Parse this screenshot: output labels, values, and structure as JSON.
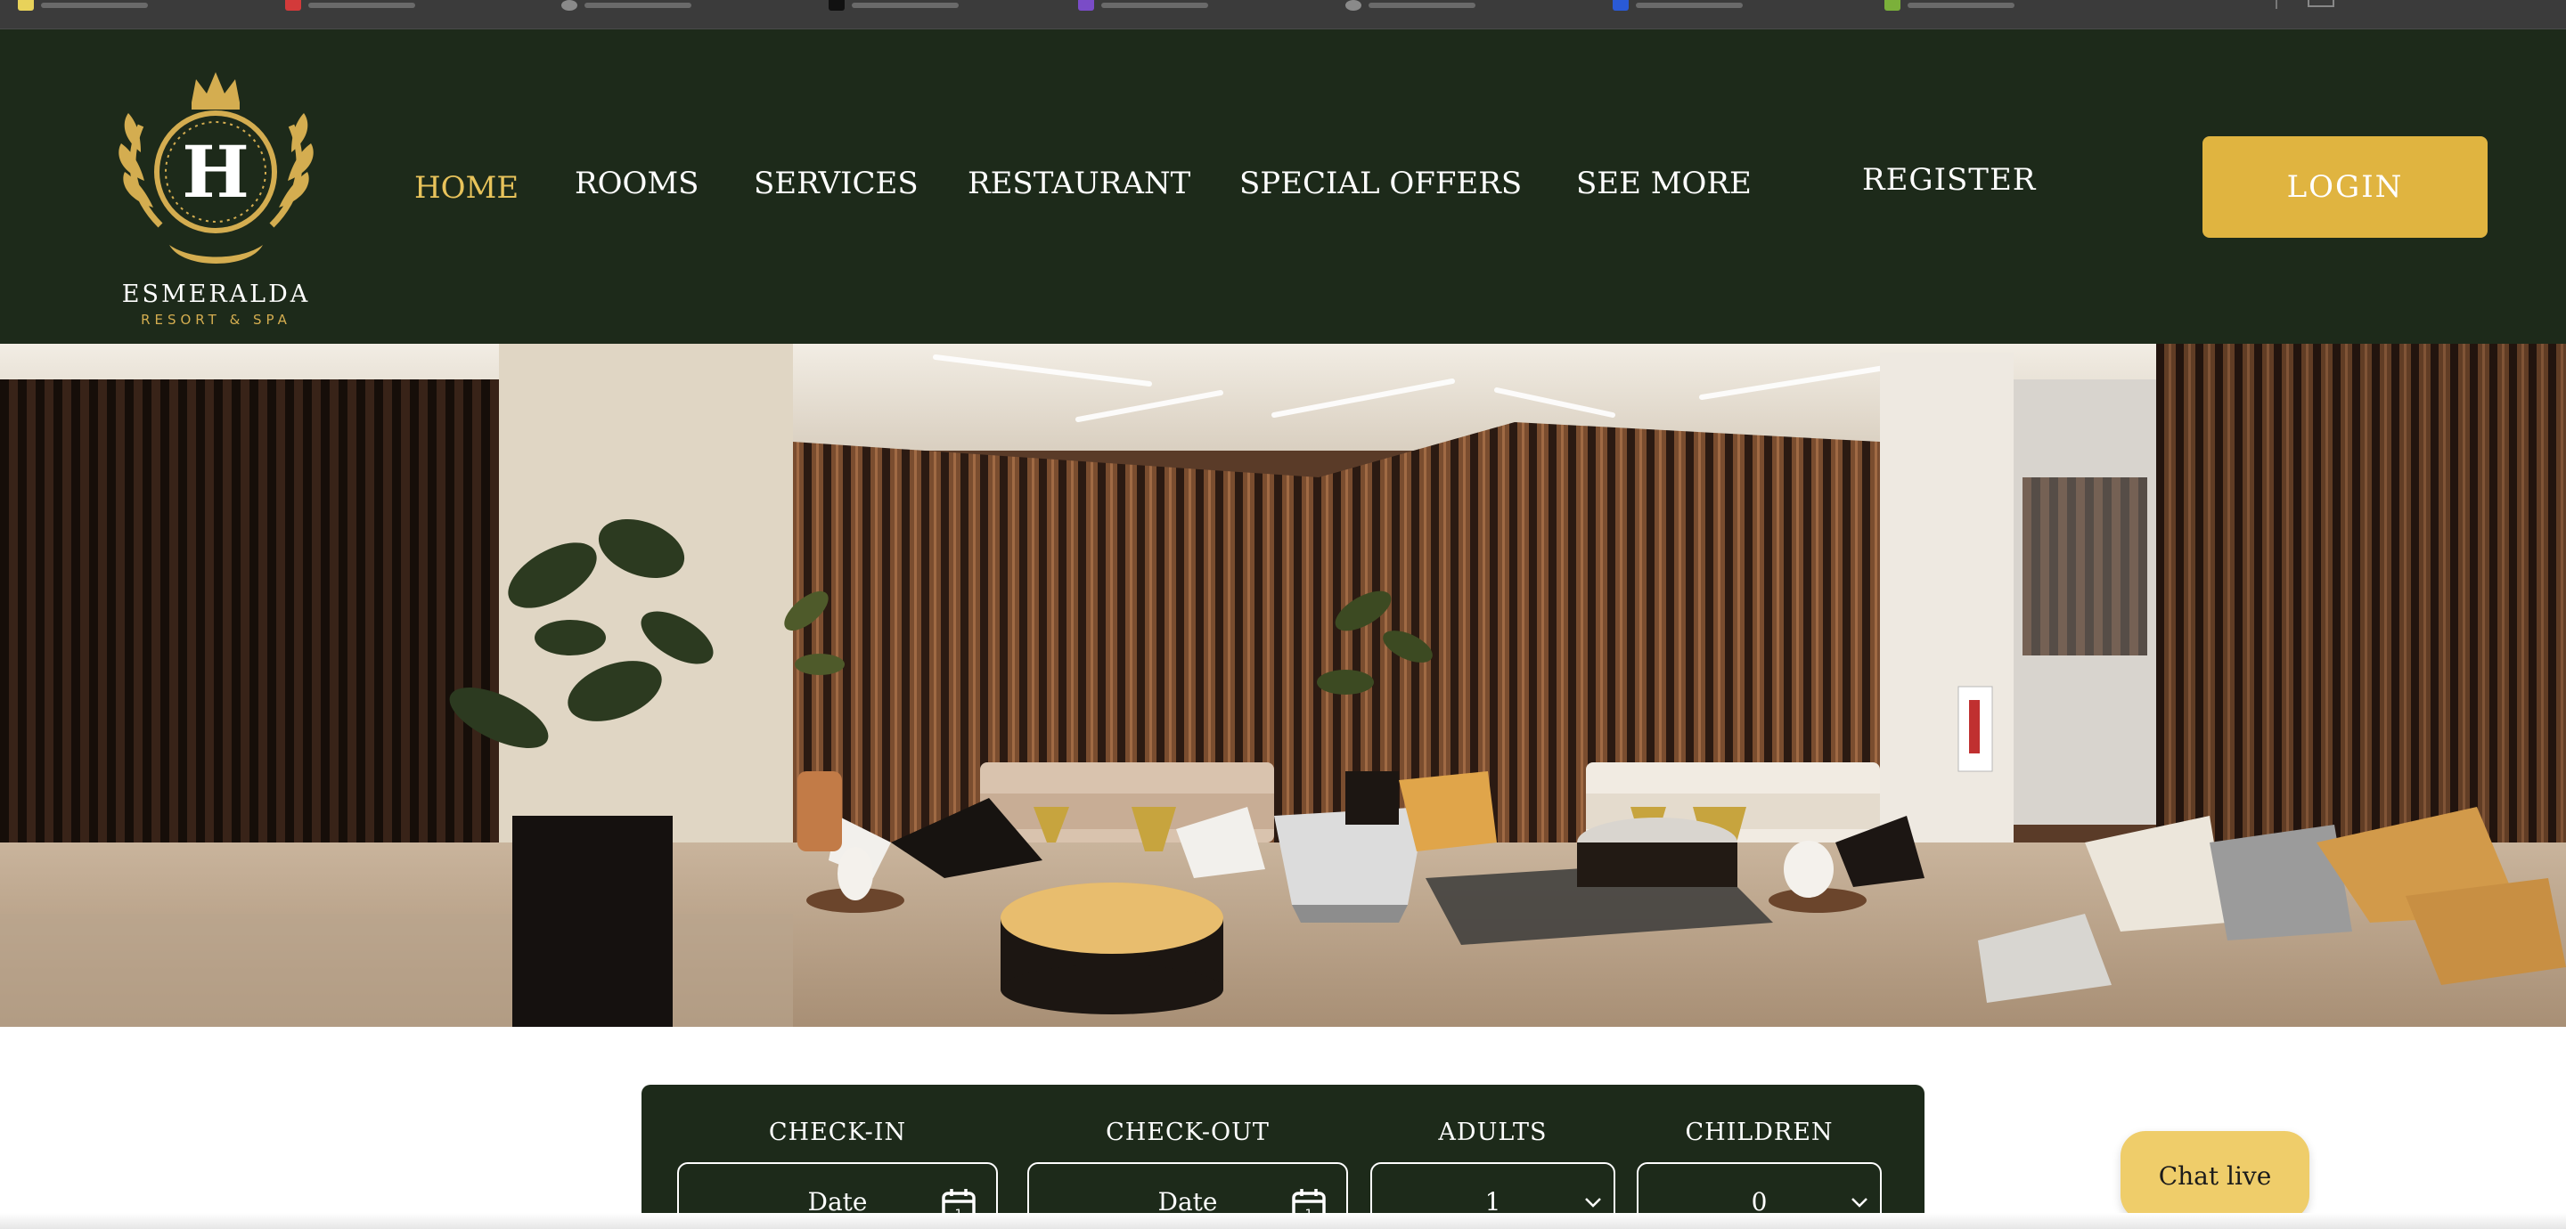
{
  "brand": {
    "monogram": "H",
    "name": "ESMERALDA",
    "tagline": "RESORT & SPA"
  },
  "nav": {
    "home": "HOME",
    "rooms": "ROOMS",
    "services": "SERVICES",
    "restaurant": "RESTAURANT",
    "special_offers": "SPECIAL OFFERS",
    "see_more": "SEE MORE",
    "register": "REGISTER",
    "login": "LOGIN"
  },
  "booking": {
    "check_in_label": "CHECK-IN",
    "check_in_value": "Date",
    "check_out_label": "CHECK-OUT",
    "check_out_value": "Date",
    "adults_label": "ADULTS",
    "adults_value": "1",
    "children_label": "CHILDREN",
    "children_value": "0"
  },
  "chat": {
    "label": "Chat live"
  },
  "icons": {
    "calendar": "calendar-icon",
    "dropdown": "chevron-down-icon",
    "logo_crest": "crest-icon"
  },
  "colors": {
    "header_bg": "#1d2a1a",
    "accent_gold": "#e0b440",
    "active_nav": "#e8c35b",
    "chat_bg": "#efcd6a"
  }
}
